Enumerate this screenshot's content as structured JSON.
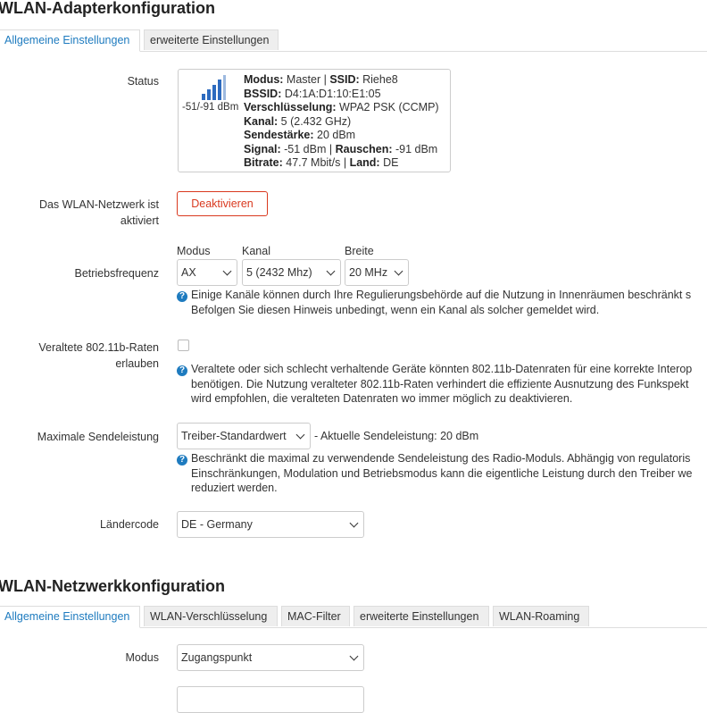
{
  "adapter": {
    "title": "WLAN-Adapterkonfiguration",
    "tabs": [
      "Allgemeine Einstellungen",
      "erweiterte Einstellungen"
    ],
    "status": {
      "label": "Status",
      "signal_text": "-51/-91 dBm",
      "signal_level": 0.8,
      "lines": [
        {
          "k1": "Modus:",
          "v1": " Master | ",
          "k2": "SSID:",
          "v2": " Riehe8"
        },
        {
          "k1": "BSSID:",
          "v1": " D4:1A:D1:10:E1:05",
          "k2": "",
          "v2": ""
        },
        {
          "k1": "Verschlüsselung:",
          "v1": " WPA2 PSK (CCMP)",
          "k2": "",
          "v2": ""
        },
        {
          "k1": "Kanal:",
          "v1": " 5 (2.432 GHz)",
          "k2": "",
          "v2": ""
        },
        {
          "k1": "Sendestärke:",
          "v1": " 20 dBm",
          "k2": "",
          "v2": ""
        },
        {
          "k1": "Signal:",
          "v1": " -51 dBm | ",
          "k2": "Rauschen:",
          "v2": " -91 dBm"
        },
        {
          "k1": "Bitrate:",
          "v1": " 47.7 Mbit/s | ",
          "k2": "Land:",
          "v2": " DE"
        }
      ]
    },
    "active": {
      "label_line1": "Das WLAN-Netzwerk ist",
      "label_line2": "aktiviert",
      "button": "Deaktivieren"
    },
    "freq": {
      "label": "Betriebsfrequenz",
      "mode_label": "Modus",
      "mode_value": "AX",
      "channel_label": "Kanal",
      "channel_value": "5 (2432 Mhz)",
      "width_label": "Breite",
      "width_value": "20 MHz",
      "hint_line1": "Einige Kanäle können durch Ihre Regulierungsbehörde auf die Nutzung in Innenräumen beschränkt s",
      "hint_line2": "Befolgen Sie diesen Hinweis unbedingt, wenn ein Kanal als solcher gemeldet wird."
    },
    "legacy": {
      "label_line1": "Veraltete 802.11b-Raten",
      "label_line2": "erlauben",
      "hint_line1": "Veraltete oder sich schlecht verhaltende Geräte könnten 802.11b-Datenraten für eine korrekte Interop",
      "hint_line2": "benötigen. Die Nutzung veralteter 802.11b-Raten verhindert die effiziente Ausnutzung des Funkspekt",
      "hint_line3": "wird empfohlen, die veralteten Datenraten wo immer möglich zu deaktivieren."
    },
    "txpower": {
      "label": "Maximale Sendeleistung",
      "value": "Treiber-Standardwert",
      "current": "- Aktuelle Sendeleistung: 20 dBm",
      "hint_line1": "Beschränkt die maximal zu verwendende Sendeleistung des Radio-Moduls. Abhängig von regulatoris",
      "hint_line2": "Einschränkungen, Modulation und Betriebsmodus kann die eigentliche Leistung durch den Treiber we",
      "hint_line3": "reduziert werden."
    },
    "country": {
      "label": "Ländercode",
      "value": "DE - Germany"
    }
  },
  "network": {
    "title": "WLAN-Netzwerkkonfiguration",
    "tabs": [
      "Allgemeine Einstellungen",
      "WLAN-Verschlüsselung",
      "MAC-Filter",
      "erweiterte Einstellungen",
      "WLAN-Roaming"
    ],
    "mode": {
      "label": "Modus",
      "value": "Zugangspunkt"
    }
  },
  "colors": {
    "accent": "#1e7bbf",
    "danger": "#d9391f"
  }
}
